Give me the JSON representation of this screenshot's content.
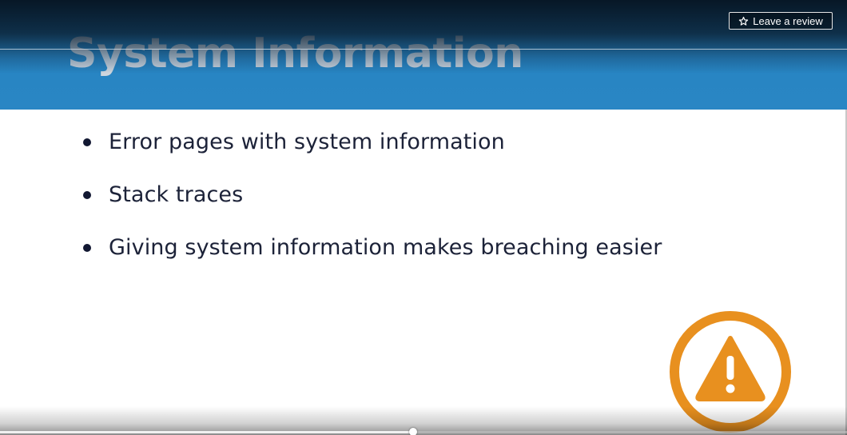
{
  "slide": {
    "title": "System Information",
    "bullets": [
      {
        "text": "Error pages with system information"
      },
      {
        "text": "Stack traces"
      },
      {
        "text": "Giving system information makes breaching easier"
      }
    ],
    "badge_icon": "warning-icon"
  },
  "player": {
    "review_button_label": "Leave a review",
    "review_button_icon": "star-outline-icon",
    "progress_fraction": 0.488
  },
  "colors": {
    "header_blue": "#2684c2",
    "title_text": "#cfd6de",
    "bullet_text": "#1c2238",
    "warning_orange": "#e8901f"
  }
}
